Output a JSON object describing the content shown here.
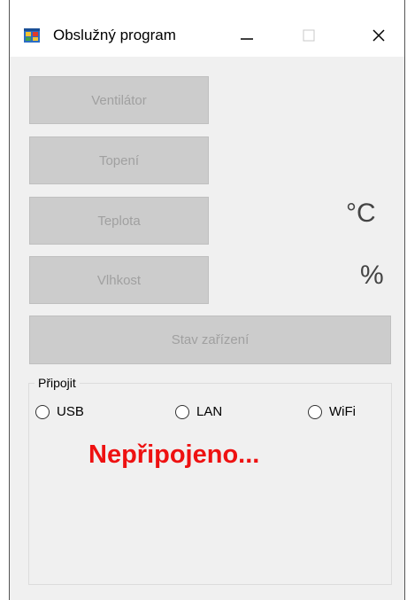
{
  "window": {
    "title": "Obslužný program",
    "app_icon": "windows-forms-icon",
    "controls": {
      "minimize_icon": "minimize-icon",
      "maximize_icon": "maximize-icon",
      "close_icon": "close-icon"
    }
  },
  "buttons": {
    "fan": "Ventilátor",
    "heating": "Topení",
    "temperature": "Teplota",
    "humidity": "Vlhkost",
    "device_status": "Stav zařízení"
  },
  "units": {
    "temperature": "°C",
    "humidity": "%"
  },
  "connect_group": {
    "legend": "Připojit",
    "options": [
      "USB",
      "LAN",
      "WiFi"
    ]
  },
  "status": {
    "text": "Nepřipojeno...",
    "color": "#ee1111"
  },
  "colors": {
    "disabled_button_bg": "#cccccc",
    "disabled_button_text": "#a0a0a0",
    "window_bg": "#f0f0f0"
  }
}
